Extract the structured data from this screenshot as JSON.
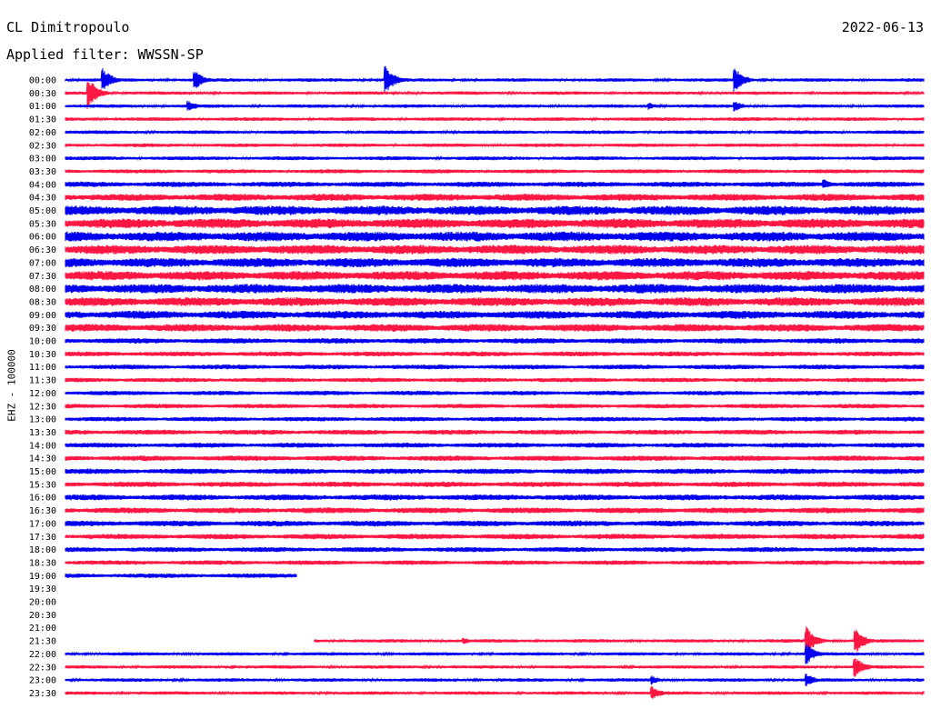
{
  "header": {
    "station": "CL Dimitropoulo",
    "filter": "Applied filter: WWSSN-SP",
    "date": "2022-06-13"
  },
  "channel_label": "EHZ - 100000",
  "colors": {
    "even_trace": "#0000ee",
    "odd_trace": "#ff1744",
    "background": "#ffffff"
  },
  "chart_data": {
    "type": "line",
    "title": "",
    "ylabel": "EHZ - 100000",
    "tick_labels": [
      "00:00",
      "00:30",
      "01:00",
      "01:30",
      "02:00",
      "02:30",
      "03:00",
      "03:30",
      "04:00",
      "04:30",
      "05:00",
      "05:30",
      "06:00",
      "06:30",
      "07:00",
      "07:30",
      "08:00",
      "08:30",
      "09:00",
      "09:30",
      "10:00",
      "10:30",
      "11:00",
      "11:30",
      "12:00",
      "12:30",
      "13:00",
      "13:30",
      "14:00",
      "14:30",
      "15:00",
      "15:30",
      "16:00",
      "16:30",
      "17:00",
      "17:30",
      "18:00",
      "18:30",
      "19:00",
      "19:30",
      "20:00",
      "20:30",
      "21:00",
      "21:30",
      "22:00",
      "22:30",
      "23:00",
      "23:30"
    ],
    "trace_noise_level": [
      1.5,
      1.5,
      1.5,
      1.6,
      1.6,
      1.6,
      1.7,
      1.8,
      2.4,
      3.2,
      4.2,
      4.4,
      4.4,
      4.2,
      4.2,
      4.2,
      4.2,
      4.0,
      3.6,
      3.4,
      2.4,
      2.2,
      2.1,
      2.0,
      2.0,
      2.0,
      2.0,
      2.2,
      2.2,
      2.4,
      2.4,
      2.4,
      2.6,
      2.6,
      2.6,
      2.4,
      2.2,
      2.0,
      2.0,
      0,
      0,
      0,
      0,
      1.5,
      1.5,
      1.5,
      1.5,
      1.5
    ],
    "trace_coverage": [
      [
        0,
        1
      ],
      [
        0,
        1
      ],
      [
        0,
        1
      ],
      [
        0,
        1
      ],
      [
        0,
        1
      ],
      [
        0,
        1
      ],
      [
        0,
        1
      ],
      [
        0,
        1
      ],
      [
        0,
        1
      ],
      [
        0,
        1
      ],
      [
        0,
        1
      ],
      [
        0,
        1
      ],
      [
        0,
        1
      ],
      [
        0,
        1
      ],
      [
        0,
        1
      ],
      [
        0,
        1
      ],
      [
        0,
        1
      ],
      [
        0,
        1
      ],
      [
        0,
        1
      ],
      [
        0,
        1
      ],
      [
        0,
        1
      ],
      [
        0,
        1
      ],
      [
        0,
        1
      ],
      [
        0,
        1
      ],
      [
        0,
        1
      ],
      [
        0,
        1
      ],
      [
        0,
        1
      ],
      [
        0,
        1
      ],
      [
        0,
        1
      ],
      [
        0,
        1
      ],
      [
        0,
        1
      ],
      [
        0,
        1
      ],
      [
        0,
        1
      ],
      [
        0,
        1
      ],
      [
        0,
        1
      ],
      [
        0,
        1
      ],
      [
        0,
        1
      ],
      [
        0,
        1
      ],
      [
        0,
        0.27
      ],
      null,
      null,
      null,
      null,
      [
        0.29,
        1
      ],
      [
        0,
        1
      ],
      [
        0,
        1
      ],
      [
        0,
        1
      ],
      [
        0,
        1
      ]
    ],
    "events": [
      {
        "trace": 0,
        "minute": 1.3,
        "amplitude": 14
      },
      {
        "trace": 0,
        "minute": 4.5,
        "amplitude": 12
      },
      {
        "trace": 0,
        "minute": 11.2,
        "amplitude": 16
      },
      {
        "trace": 0,
        "minute": 23.4,
        "amplitude": 14
      },
      {
        "trace": 1,
        "minute": 0.8,
        "amplitude": 18
      },
      {
        "trace": 2,
        "minute": 4.3,
        "amplitude": 6
      },
      {
        "trace": 2,
        "minute": 20.4,
        "amplitude": 4
      },
      {
        "trace": 2,
        "minute": 23.4,
        "amplitude": 6
      },
      {
        "trace": 8,
        "minute": 26.5,
        "amplitude": 6
      },
      {
        "trace": 43,
        "minute": 13.9,
        "amplitude": 4
      },
      {
        "trace": 43,
        "minute": 25.9,
        "amplitude": 16
      },
      {
        "trace": 43,
        "minute": 27.6,
        "amplitude": 16
      },
      {
        "trace": 44,
        "minute": 25.9,
        "amplitude": 12
      },
      {
        "trace": 45,
        "minute": 27.6,
        "amplitude": 12
      },
      {
        "trace": 46,
        "minute": 20.5,
        "amplitude": 5
      },
      {
        "trace": 46,
        "minute": 25.9,
        "amplitude": 8
      },
      {
        "trace": 47,
        "minute": 20.5,
        "amplitude": 8
      }
    ],
    "x_range_minutes": [
      0,
      30
    ],
    "grid": false,
    "legend": "none"
  }
}
